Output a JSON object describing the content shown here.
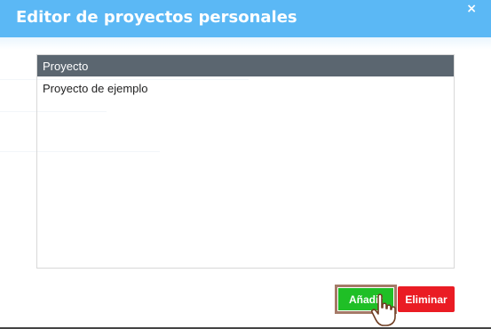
{
  "dialog": {
    "title": "Editor de proyectos personales",
    "close_icon": "close-icon",
    "close_glyph": "×"
  },
  "table": {
    "header": "Proyecto",
    "rows": [
      "Proyecto de ejemplo"
    ]
  },
  "actions": {
    "add_label": "Añadir",
    "delete_label": "Eliminar"
  },
  "colors": {
    "titlebar": "#5bb8f5",
    "table_header": "#5b6670",
    "add_button": "#1fbf26",
    "delete_button": "#ea1c24"
  },
  "cursor_icon": "hand-pointer-icon"
}
